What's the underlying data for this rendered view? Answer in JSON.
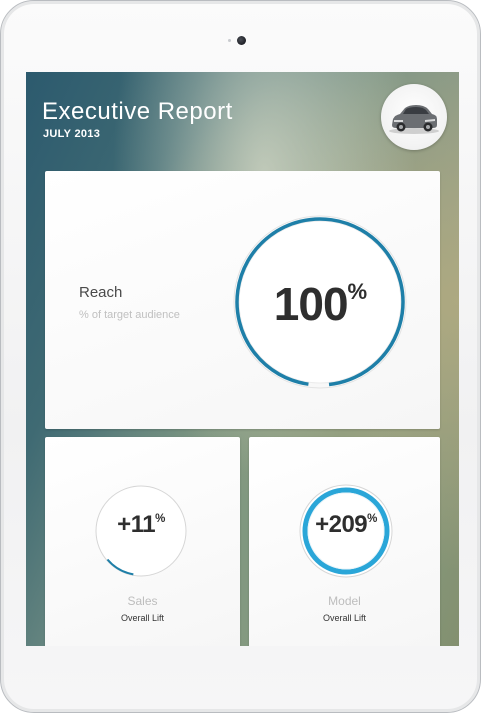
{
  "header": {
    "title": "Executive Report",
    "subtitle": "JULY 2013",
    "avatar_icon": "car-icon"
  },
  "reach": {
    "label": "Reach",
    "sublabel": "% of target audience",
    "value": "100",
    "unit": "%",
    "progress": 1.0
  },
  "sales": {
    "value": "+11",
    "unit": "%",
    "label": "Sales",
    "sublabel": "Overall Lift",
    "progress": 0.11
  },
  "model": {
    "value": "+209",
    "unit": "%",
    "label": "Model",
    "sublabel": "Overall Lift",
    "progress": 1.0
  },
  "colors": {
    "accent": "#1e7fa8",
    "accent_light": "#2aa6d8",
    "text_dark": "#2e2e2e",
    "text_muted": "#bdbdbd"
  }
}
